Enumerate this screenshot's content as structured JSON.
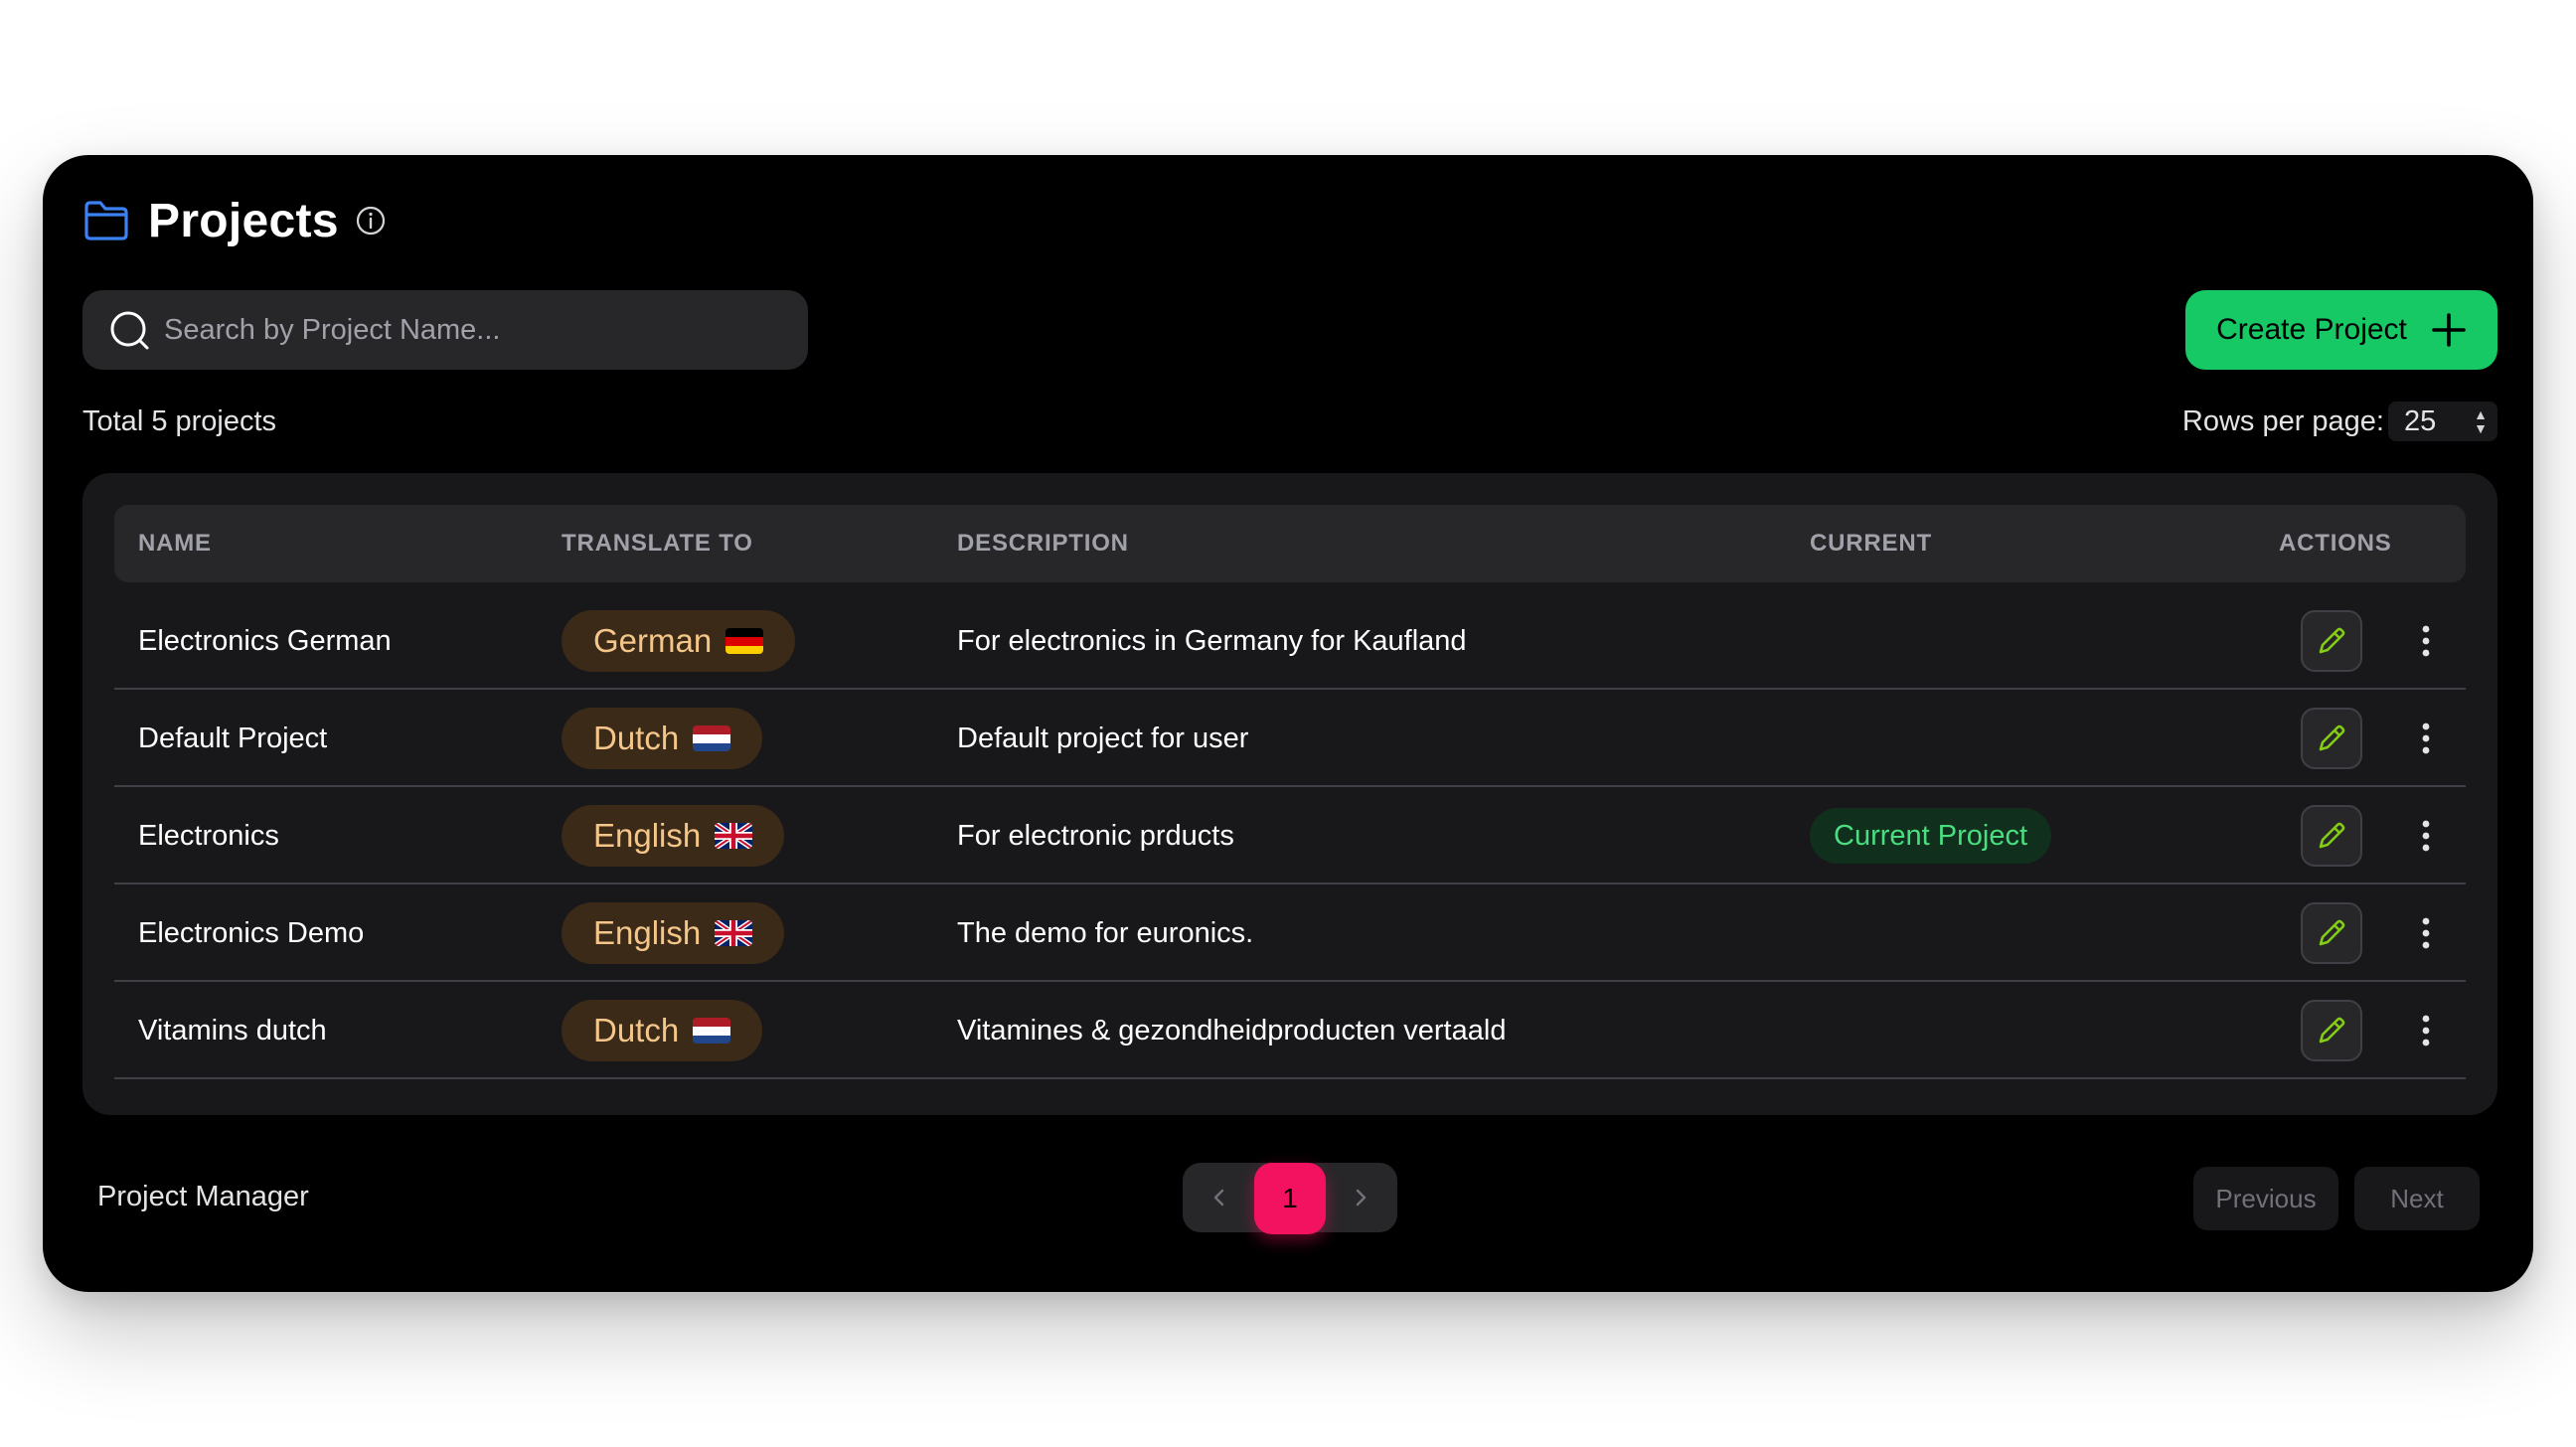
{
  "header": {
    "title": "Projects"
  },
  "search": {
    "placeholder": "Search by Project Name..."
  },
  "toolbar": {
    "create_label": "Create Project",
    "total_label": "Total 5 projects",
    "rows_per_page_label": "Rows per page:",
    "rows_per_page_value": "25"
  },
  "table": {
    "columns": [
      "NAME",
      "TRANSLATE TO",
      "DESCRIPTION",
      "CURRENT",
      "ACTIONS"
    ],
    "rows": [
      {
        "name": "Electronics German",
        "language": "German",
        "flag": "de",
        "description": "For electronics in Germany for Kaufland",
        "current": ""
      },
      {
        "name": "Default Project",
        "language": "Dutch",
        "flag": "nl",
        "description": "Default project for user",
        "current": ""
      },
      {
        "name": "Electronics",
        "language": "English",
        "flag": "gb",
        "description": "For electronic prducts",
        "current": "Current Project"
      },
      {
        "name": "Electronics Demo",
        "language": "English",
        "flag": "gb",
        "description": "The demo for euronics.",
        "current": ""
      },
      {
        "name": "Vitamins dutch",
        "language": "Dutch",
        "flag": "nl",
        "description": "Vitamines & gezondheidproducten vertaald",
        "current": ""
      }
    ]
  },
  "footer": {
    "label": "Project Manager",
    "current_page": "1",
    "previous_label": "Previous",
    "next_label": "Next"
  },
  "colors": {
    "accent_green": "#17c964",
    "page_active": "#f31260",
    "folder_blue": "#3b82f6",
    "edit_icon_green": "#84cc16"
  }
}
